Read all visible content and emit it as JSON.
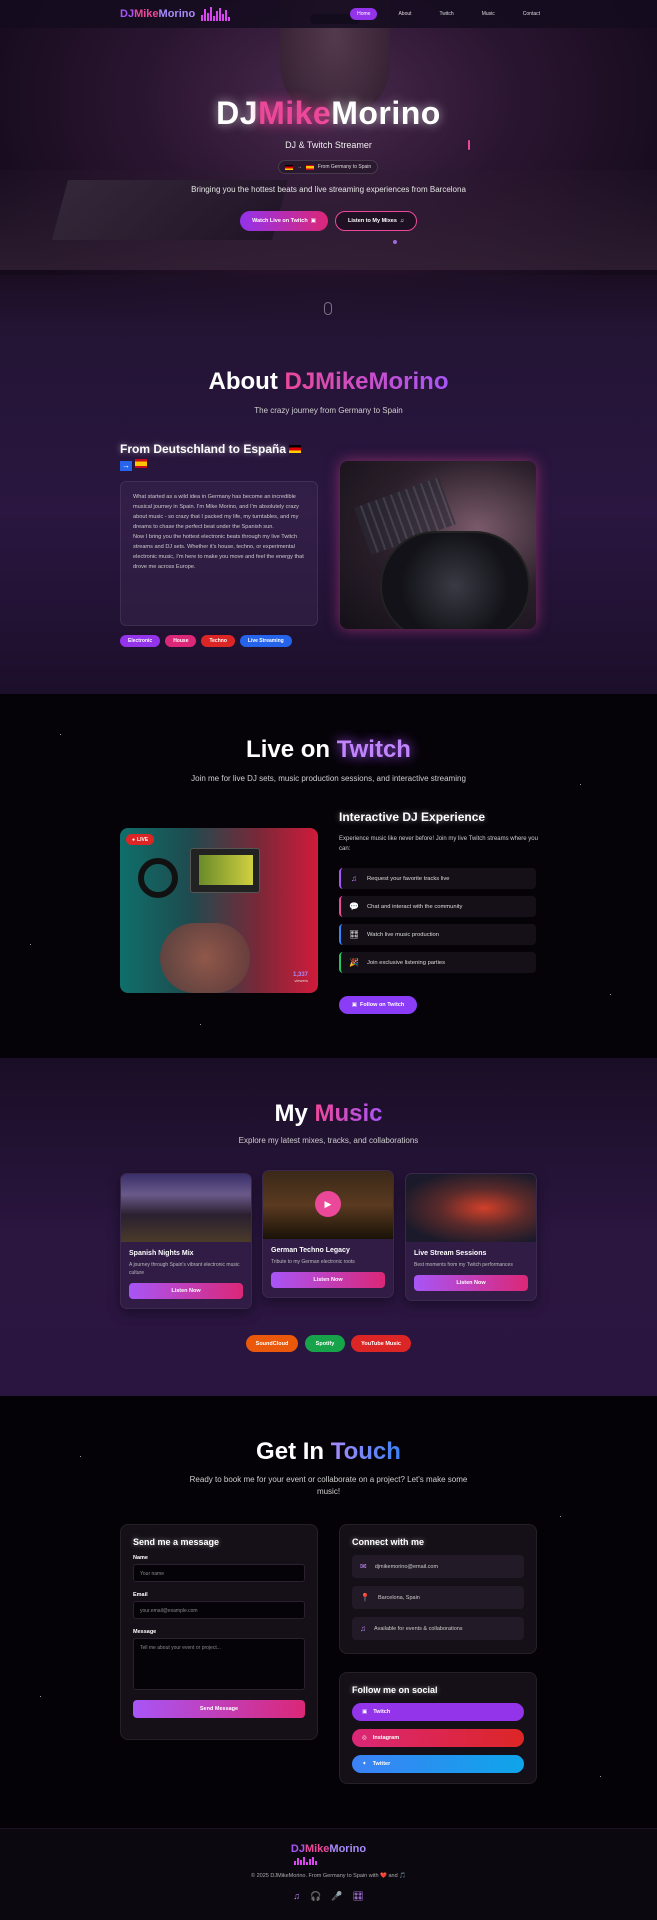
{
  "nav": {
    "brand": {
      "dj": "DJ",
      "mike": "Mike",
      "morino": "Morino"
    },
    "links": [
      "Home",
      "About",
      "Twitch",
      "Music",
      "Contact"
    ]
  },
  "hero": {
    "title_dj": "DJ",
    "title_mike": "Mike",
    "title_morino": "Morino",
    "subtitle": "DJ & Twitch Streamer",
    "origin": "From Germany to Spain",
    "tagline": "Bringing you the hottest beats and live streaming experiences from Barcelona",
    "btn_watch": "Watch Live on Twitch",
    "btn_listen": "Listen to My Mixes"
  },
  "about": {
    "title_plain": "About",
    "title_grad": "DJMikeMorino",
    "subtitle": "The crazy journey from Germany to Spain",
    "heading": "From Deutschland to España",
    "text1": "What started as a wild idea in Germany has become an incredible musical journey in Spain. I'm Mike Morino, and I'm absolutely crazy about music - so crazy that I packed my life, my turntables, and my dreams to chase the perfect beat under the Spanish sun.",
    "text2": "Now I bring you the hottest electronic beats through my live Twitch streams and DJ sets. Whether it's house, techno, or experimental electronic music, I'm here to make you move and feel the energy that drove me across Europe.",
    "tags": [
      {
        "label": "Electronic",
        "color": "#9333ea"
      },
      {
        "label": "House",
        "color": "#db2777"
      },
      {
        "label": "Techno",
        "color": "#dc2626"
      },
      {
        "label": "Live Streaming",
        "color": "#2563eb"
      }
    ]
  },
  "twitch": {
    "title_plain": "Live on",
    "title_grad": "Twitch",
    "subtitle": "Join me for live DJ sets, music production sessions, and interactive streaming",
    "live_label": "LIVE",
    "viewers_count": "1,337",
    "viewers_label": "viewers",
    "heading": "Interactive DJ Experience",
    "desc": "Experience music like never before! Join my live Twitch streams where you can:",
    "features": [
      {
        "icon": "♫",
        "text": "Request your favorite tracks live",
        "color": "#a855f7"
      },
      {
        "icon": "💬",
        "text": "Chat and interact with the community",
        "color": "#ec4899"
      },
      {
        "icon": "🎛",
        "text": "Watch live music production",
        "color": "#3b82f6"
      },
      {
        "icon": "🎉",
        "text": "Join exclusive listening parties",
        "color": "#22c55e"
      }
    ],
    "btn": "Follow on Twitch"
  },
  "music": {
    "title_plain": "My",
    "title_grad": "Music",
    "subtitle": "Explore my latest mixes, tracks, and collaborations",
    "cards": [
      {
        "title": "Spanish Nights Mix",
        "desc": "A journey through Spain's vibrant electronic music culture",
        "btn": "Listen Now"
      },
      {
        "title": "German Techno Legacy",
        "desc": "Tribute to my German electronic roots",
        "btn": "Listen Now"
      },
      {
        "title": "Live Stream Sessions",
        "desc": "Best moments from my Twitch performances",
        "btn": "Listen Now"
      }
    ],
    "platforms": [
      {
        "label": "SoundCloud",
        "color": "#ea580c"
      },
      {
        "label": "Spotify",
        "color": "#16a34a"
      },
      {
        "label": "YouTube Music",
        "color": "#dc2626"
      }
    ]
  },
  "contact": {
    "title_plain": "Get In",
    "title_grad": "Touch",
    "subtitle": "Ready to book me for your event or collaborate on a project? Let's make some music!",
    "form": {
      "heading": "Send me a message",
      "name_label": "Name",
      "name_placeholder": "Your name",
      "email_label": "Email",
      "email_placeholder": "your.email@example.com",
      "message_label": "Message",
      "message_placeholder": "Tell me about your event or project...",
      "submit": "Send Message"
    },
    "connect": {
      "heading": "Connect with me",
      "email": "djmikemorino@email.com",
      "location": "Barcelona, Spain",
      "availability": "Available for events & collaborations"
    },
    "social": {
      "heading": "Follow me on social",
      "twitch": "Twitch",
      "instagram": "Instagram",
      "twitter": "Twitter"
    }
  },
  "footer": {
    "brand_dj": "DJ",
    "brand_mike": "Mike",
    "brand_morino": "Morino",
    "copyright": "© 2025 DJMikeMorino. From Germany to Spain with ❤️ and 🎵"
  }
}
